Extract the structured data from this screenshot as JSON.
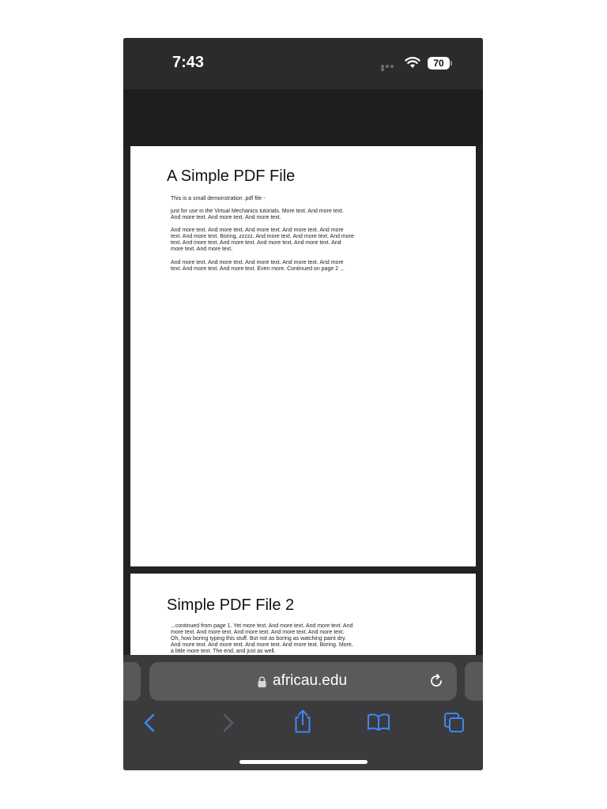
{
  "status_bar": {
    "time": "7:43",
    "battery_level": "70"
  },
  "pdf": {
    "pages": [
      {
        "title": "A Simple PDF File",
        "paragraphs": [
          "This is a small demonstration .pdf file -",
          "just for use in the Virtual Mechanics tutorials. More text. And more text. And more text. And more text. And more text.",
          "And more text. And more text. And more text. And more text. And more text. And more text. Boring, zzzzz. And more text. And more text. And more text. And more text. And more text. And more text. And more text. And more text. And more text.",
          "And more text. And more text. And more text. And more text. And more text. And more text. And more text. Even more. Continued on page 2 ..."
        ]
      },
      {
        "title": "Simple PDF File 2",
        "paragraphs": [
          "...continued from page 1. Yet more text. And more text. And more text. And more text. And more text. And more text. And more text. And more text. Oh, how boring typing this stuff. But not as boring as watching paint dry. And more text. And more text. And more text. And more text. Boring.  More, a little more text. The end, and just as well."
        ]
      }
    ]
  },
  "browser": {
    "url": "africau.edu",
    "accent_color": "#3c87f7"
  },
  "icons": {
    "wifi": "wifi-icon",
    "lock": "lock-icon",
    "reload": "reload-icon",
    "back": "back-icon",
    "forward": "forward-icon",
    "share": "share-icon",
    "bookmarks": "bookmarks-icon",
    "tabs": "tabs-icon"
  }
}
